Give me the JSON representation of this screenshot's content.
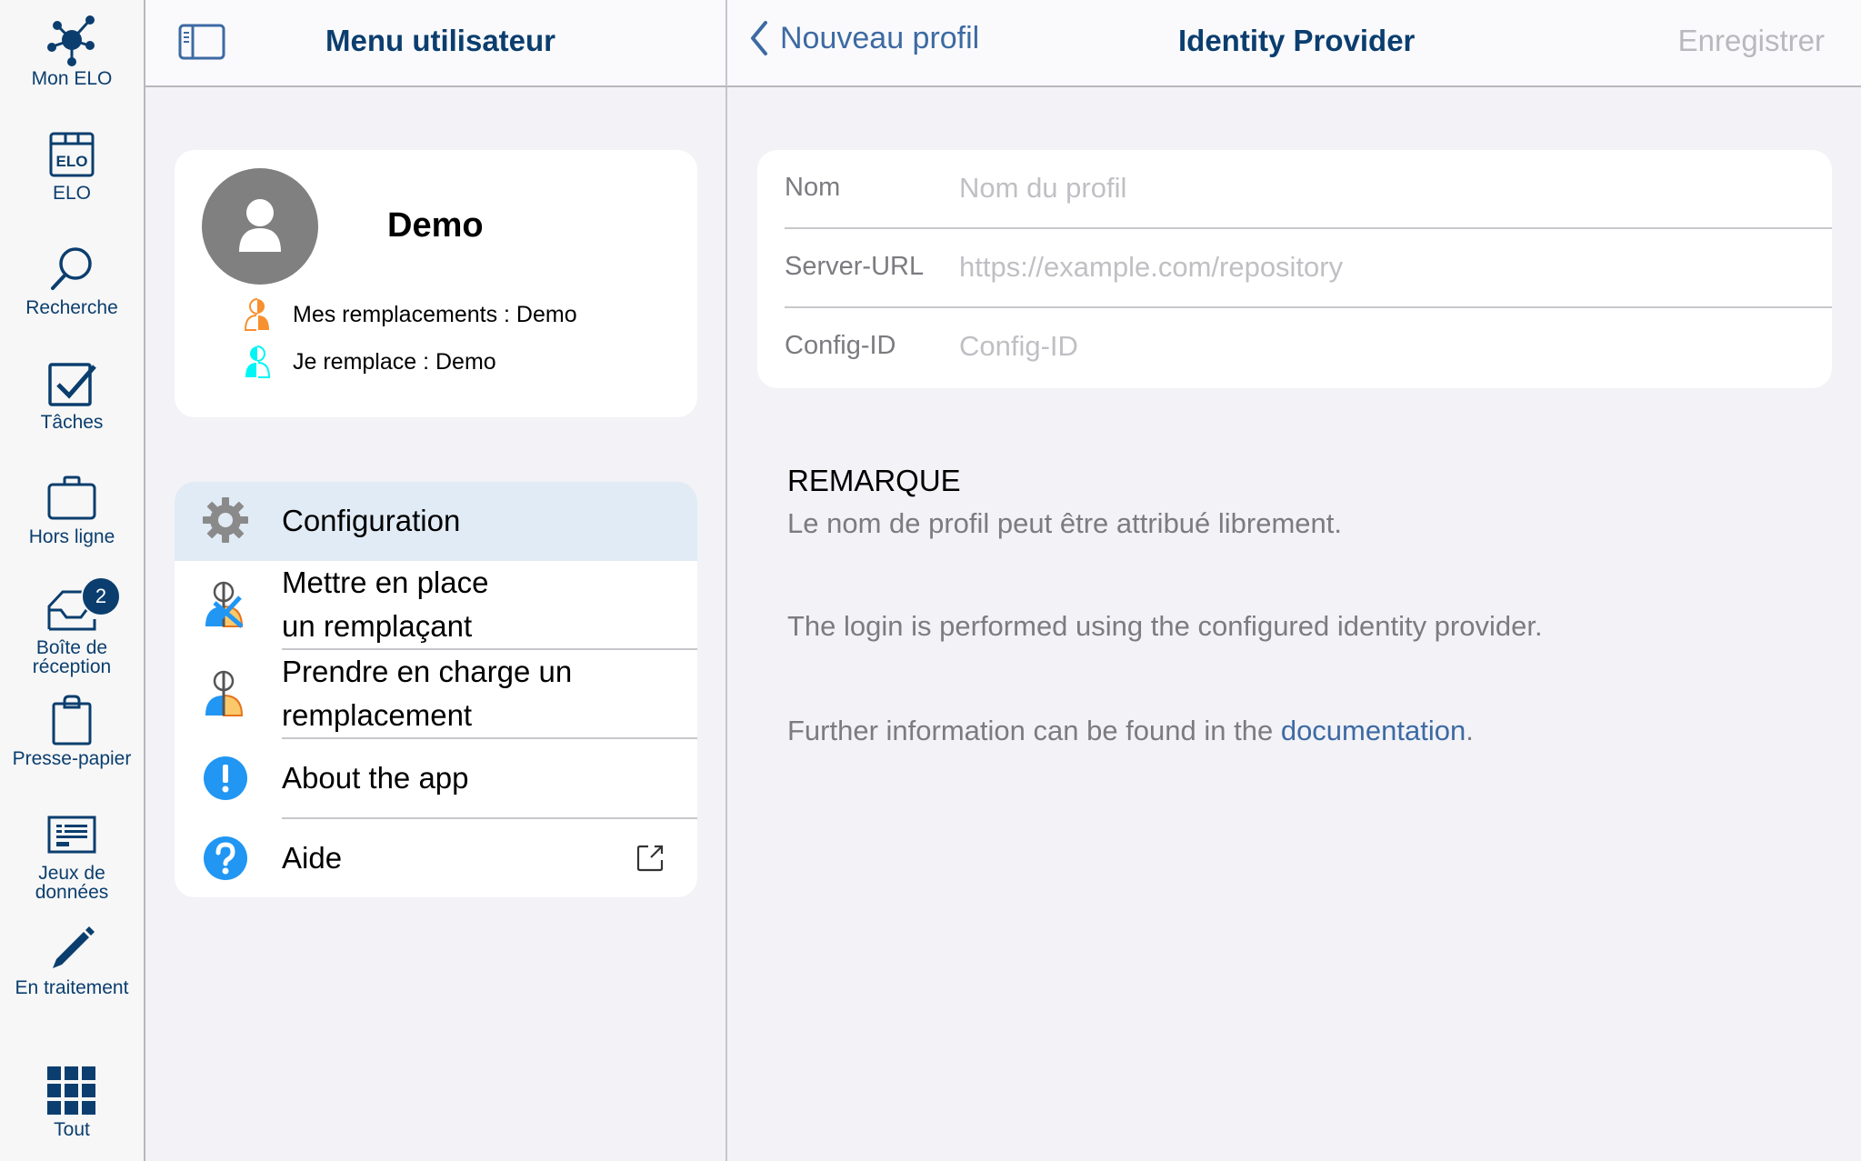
{
  "rail": {
    "items": [
      {
        "id": "mon-elo",
        "label": "Mon ELO",
        "icon": "network-icon"
      },
      {
        "id": "elo",
        "label": "ELO",
        "icon": "elo-repository-icon"
      },
      {
        "id": "recherche",
        "label": "Recherche",
        "icon": "search-icon"
      },
      {
        "id": "taches",
        "label": "Tâches",
        "icon": "checkbox-icon"
      },
      {
        "id": "hors-ligne",
        "label": "Hors ligne",
        "icon": "briefcase-icon"
      },
      {
        "id": "boite",
        "label_line1": "Boîte de",
        "label_line2": "réception",
        "icon": "inbox-icon",
        "badge": "2"
      },
      {
        "id": "presse-papier",
        "label": "Presse-papier",
        "icon": "clipboard-icon"
      },
      {
        "id": "jeux",
        "label_line1": "Jeux de",
        "label_line2": "données",
        "icon": "dataset-icon"
      },
      {
        "id": "en-traitement",
        "label": "En traitement",
        "icon": "pencil-icon"
      },
      {
        "id": "tout",
        "label": "Tout",
        "icon": "grid-icon"
      }
    ]
  },
  "middle": {
    "header_title": "Menu utilisateur",
    "profile": {
      "name": "Demo",
      "my_substitutes_label": "Mes remplacements : Demo",
      "i_substitute_label": "Je remplace : Demo"
    },
    "menu": [
      {
        "label": "Configuration",
        "icon": "gear-icon",
        "selected": true
      },
      {
        "label_line1": "Mettre en place",
        "label_line2": "un remplaçant",
        "icon": "setup-substitute-icon"
      },
      {
        "label_line1": "Prendre en charge un",
        "label_line2": "remplacement",
        "icon": "take-over-substitute-icon"
      },
      {
        "label": "About the app",
        "icon": "info-icon"
      },
      {
        "label": "Aide",
        "icon": "help-icon",
        "trailing_icon": "external-link-icon"
      }
    ]
  },
  "right": {
    "back_label": "Nouveau profil",
    "header_title": "Identity Provider",
    "save_label": "Enregistrer",
    "form": [
      {
        "label": "Nom",
        "value": "",
        "placeholder": "Nom du profil"
      },
      {
        "label": "Server-URL",
        "value": "",
        "placeholder": "https://example.com/repository"
      },
      {
        "label": "Config-ID",
        "value": "",
        "placeholder": "Config-ID"
      }
    ],
    "note": {
      "title": "REMARQUE",
      "line1": "Le nom de profil peut être attribué librement.",
      "line2": "The login is performed using the configured identity provider.",
      "line3_prefix": "Further information can be found in the ",
      "line3_link": "documentation",
      "line3_suffix": "."
    }
  },
  "colors": {
    "brand_navy": "#0b3e6e",
    "link_blue": "#3d6aa3",
    "selected_row": "#e1ebf5",
    "orange": "#f7902e",
    "cyan": "#00f5f5",
    "info_blue": "#2196f3"
  }
}
